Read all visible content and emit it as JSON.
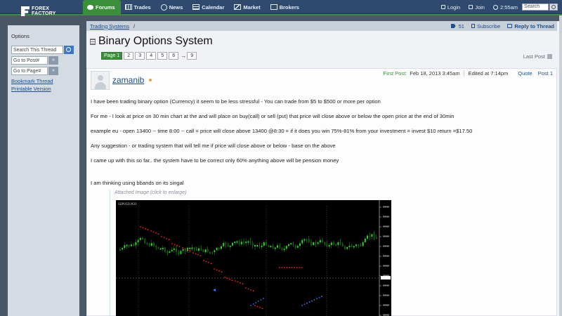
{
  "nav": {
    "logo_line1": "FOREX",
    "logo_line2": "FACTORY",
    "items": [
      {
        "label": "Forums",
        "icon": "chat-bubble-icon",
        "active": true
      },
      {
        "label": "Trades",
        "icon": "table-icon"
      },
      {
        "label": "News",
        "icon": "globe-icon"
      },
      {
        "label": "Calendar",
        "icon": "calendar-icon"
      },
      {
        "label": "Market",
        "icon": "market-chart-icon"
      },
      {
        "label": "Brokers",
        "icon": "broker-icon"
      }
    ],
    "login": "Login",
    "join": "Join",
    "time": "2:55am",
    "search_placeholder": "Search"
  },
  "sidebar": {
    "title": "Options",
    "search_thread": "Search This Thread",
    "go_to_post": "Go to Post#",
    "go_to_page": "Go to Page#",
    "go_label": "»",
    "bookmark": "Bookmark Thread",
    "printable": "Printable Version"
  },
  "breadcrumb": {
    "section": "Trading Systems",
    "separator": "/",
    "tag_count": "51",
    "subscribe": "Subscribe",
    "reply": "Reply to Thread"
  },
  "thread": {
    "title": "Binary Options System",
    "pages": [
      "Page 1",
      "2",
      "3",
      "4",
      "5",
      "6"
    ],
    "arrow": "→",
    "last_page": "9",
    "last_post": "Last Post"
  },
  "post": {
    "username": "zamanib",
    "first_post_label": "First Post:",
    "date": "Feb 18, 2013 3:45am",
    "edited": "Edited at 7:14pm",
    "quote": "Quote",
    "post_no": "Post 1",
    "lines": [
      "I have been trading binary option (Currency) it seem to be less stressful - You can trade from $5 to $500 or more per option",
      "For me - I look at price on 30 min chart at the and will place on buy(call) or sell (put) that price will close above or below the open price at the end of 30min",
      "example eu - open 13400 -- time 8:00 -- call = price will close above 13400 @8:30 = if it does you win 75%-81% from your investment = invest $10 return =$17.50",
      "Any suggestion - or trading system that will tell me if price will close above or below - base on the above",
      "I came up with this so far.. the system have to be correct only 60% anything above will be pension money",
      "I am thinking using bbands on its singal"
    ],
    "attached_label": "Attached Image (click to enlarge)"
  },
  "colors": {
    "nav_bg": "#2f4a6e",
    "accent_green": "#3a8f3a",
    "link_blue": "#1a4e8c",
    "chart_bg": "#000000",
    "signal_red": "#ff2020",
    "signal_blue": "#3a7bff"
  }
}
